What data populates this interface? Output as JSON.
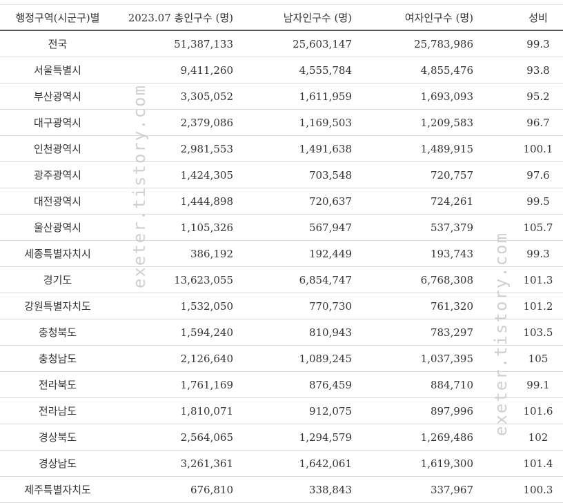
{
  "table": {
    "headers": [
      "행정구역(시군구)별",
      "2023.07 총인구수 (명)",
      "남자인구수 (명)",
      "여자인구수 (명)",
      "성비"
    ],
    "rows": [
      [
        "전국",
        "51,387,133",
        "25,603,147",
        "25,783,986",
        "99.3"
      ],
      [
        "서울특별시",
        "9,411,260",
        "4,555,784",
        "4,855,476",
        "93.8"
      ],
      [
        "부산광역시",
        "3,305,052",
        "1,611,959",
        "1,693,093",
        "95.2"
      ],
      [
        "대구광역시",
        "2,379,086",
        "1,169,503",
        "1,209,583",
        "96.7"
      ],
      [
        "인천광역시",
        "2,981,553",
        "1,491,638",
        "1,489,915",
        "100.1"
      ],
      [
        "광주광역시",
        "1,424,305",
        "703,548",
        "720,757",
        "97.6"
      ],
      [
        "대전광역시",
        "1,444,898",
        "720,637",
        "724,261",
        "99.5"
      ],
      [
        "울산광역시",
        "1,105,326",
        "567,947",
        "537,379",
        "105.7"
      ],
      [
        "세종특별자치시",
        "386,192",
        "192,449",
        "193,743",
        "99.3"
      ],
      [
        "경기도",
        "13,623,055",
        "6,854,747",
        "6,768,308",
        "101.3"
      ],
      [
        "강원특별자치도",
        "1,532,050",
        "770,730",
        "761,320",
        "101.2"
      ],
      [
        "충청북도",
        "1,594,240",
        "810,943",
        "783,297",
        "103.5"
      ],
      [
        "충청남도",
        "2,126,640",
        "1,089,245",
        "1,037,395",
        "105"
      ],
      [
        "전라북도",
        "1,761,169",
        "876,459",
        "884,710",
        "99.1"
      ],
      [
        "전라남도",
        "1,810,071",
        "912,075",
        "897,996",
        "101.6"
      ],
      [
        "경상북도",
        "2,564,065",
        "1,294,579",
        "1,269,486",
        "102"
      ],
      [
        "경상남도",
        "3,261,361",
        "1,642,061",
        "1,619,300",
        "101.4"
      ],
      [
        "제주특별자치도",
        "676,810",
        "338,843",
        "337,967",
        "100.3"
      ]
    ]
  },
  "watermark": "exeter.tistory.com"
}
